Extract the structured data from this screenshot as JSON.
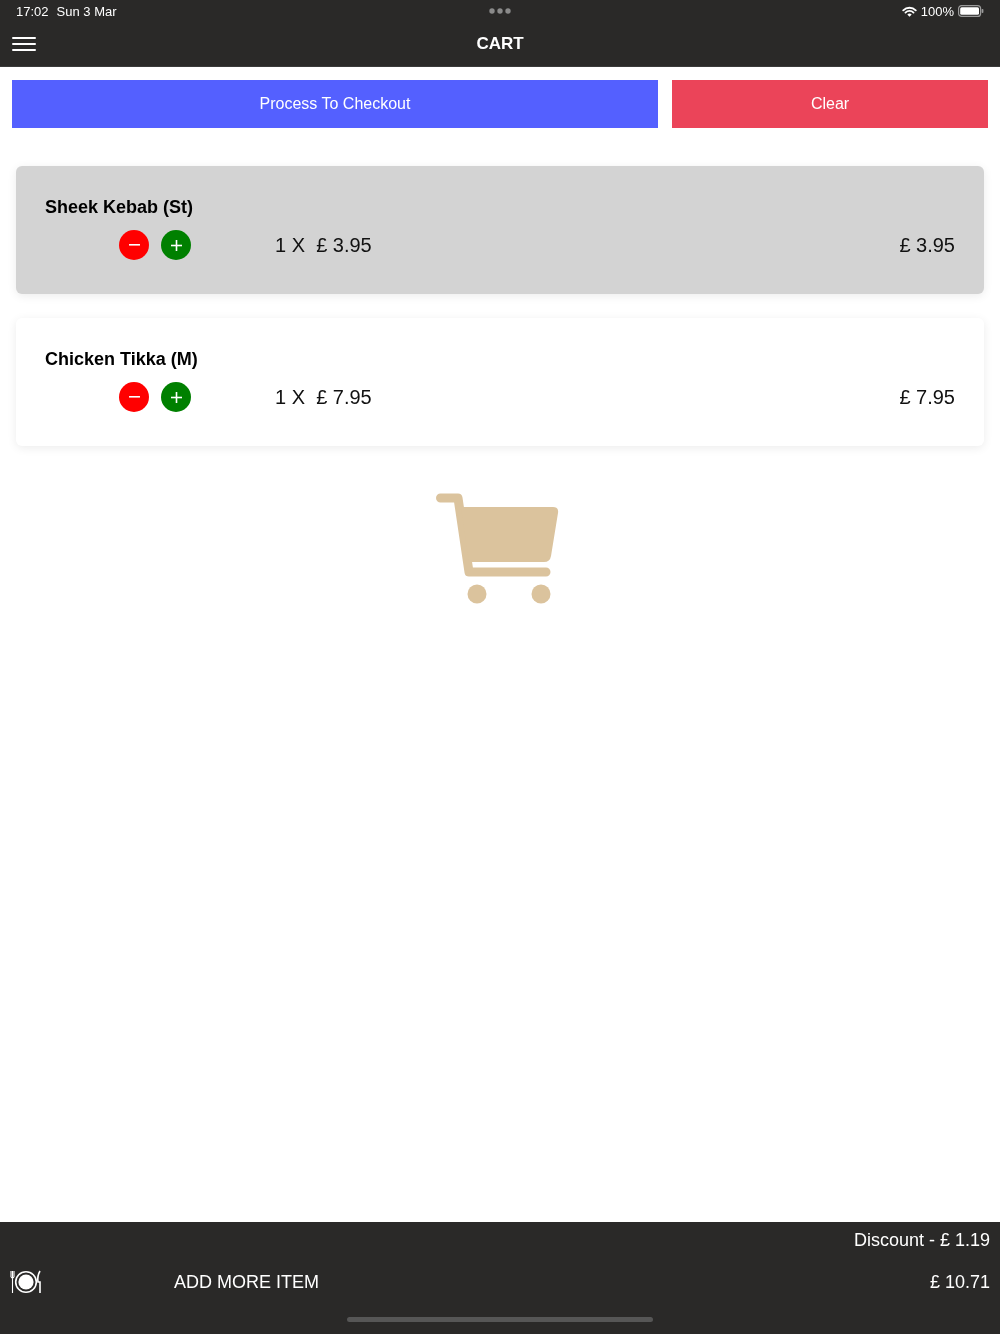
{
  "status_bar": {
    "time": "17:02",
    "date": "Sun 3 Mar",
    "battery": "100%"
  },
  "nav_bar": {
    "title": "CART"
  },
  "actions": [
    {
      "label": "Process To Checkout",
      "kind": "primary"
    },
    {
      "label": "Clear",
      "kind": "danger"
    }
  ],
  "cart_items": [
    {
      "name": "Sheek Kebab (St)",
      "quantity_price": "1 X  £ 3.95",
      "total": "£ 3.95",
      "selected": true
    },
    {
      "name": "Chicken Tikka (M)",
      "quantity_price": "1 X  £ 7.95",
      "total": "£ 7.95",
      "selected": false
    }
  ],
  "footer": {
    "discount": "Discount - £ 1.19",
    "add_more": "ADD MORE ITEM",
    "total": "£ 10.71"
  }
}
